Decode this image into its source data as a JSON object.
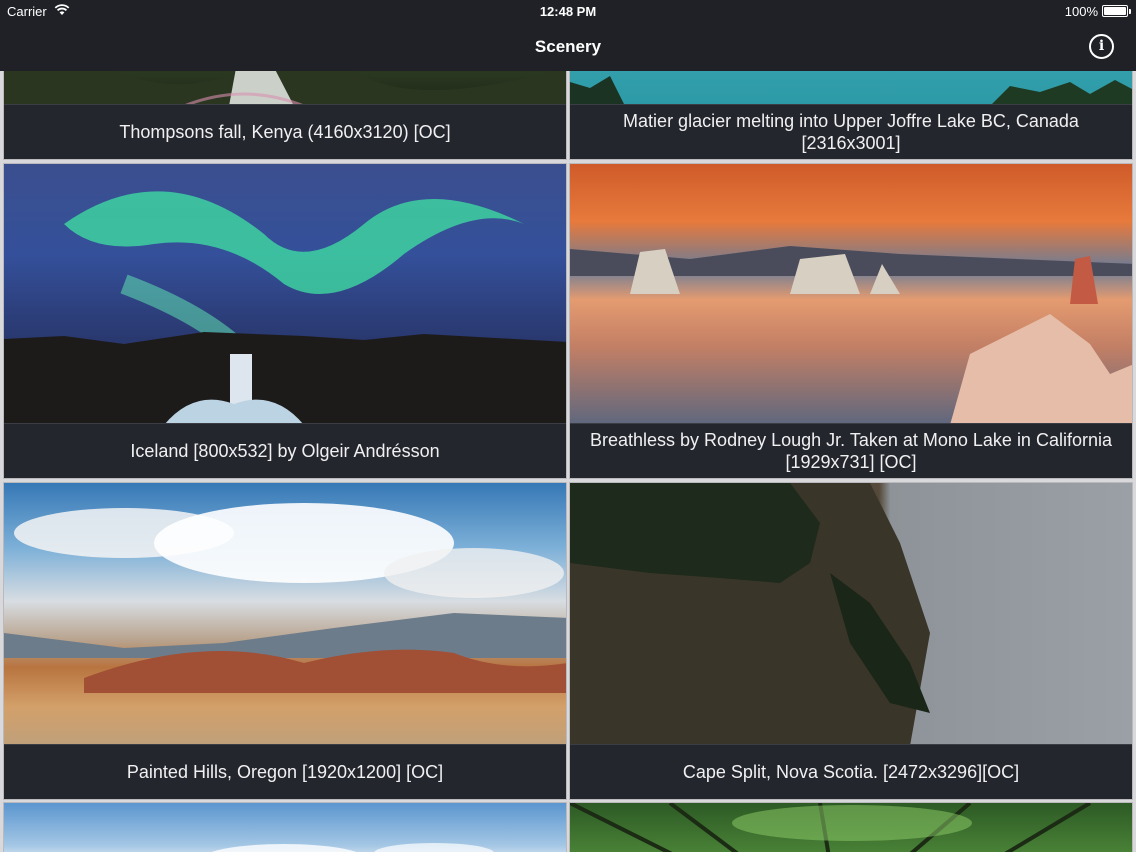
{
  "status_bar": {
    "carrier": "Carrier",
    "time": "12:48 PM",
    "battery_percent": "100%"
  },
  "nav": {
    "title": "Scenery",
    "info_icon": "info-icon"
  },
  "items": [
    {
      "caption": "Thompsons fall, Kenya (4160x3120) [OC]"
    },
    {
      "caption": "Matier glacier melting into Upper Joffre Lake BC, Canada [2316x3001]"
    },
    {
      "caption": "Iceland [800x532] by Olgeir Andrésson"
    },
    {
      "caption": "Breathless by Rodney Lough Jr. Taken at Mono Lake in California [1929x731] [OC]"
    },
    {
      "caption": "Painted Hills, Oregon [1920x1200] [OC]"
    },
    {
      "caption": "Cape Split, Nova Scotia. [2472x3296][OC]"
    }
  ]
}
